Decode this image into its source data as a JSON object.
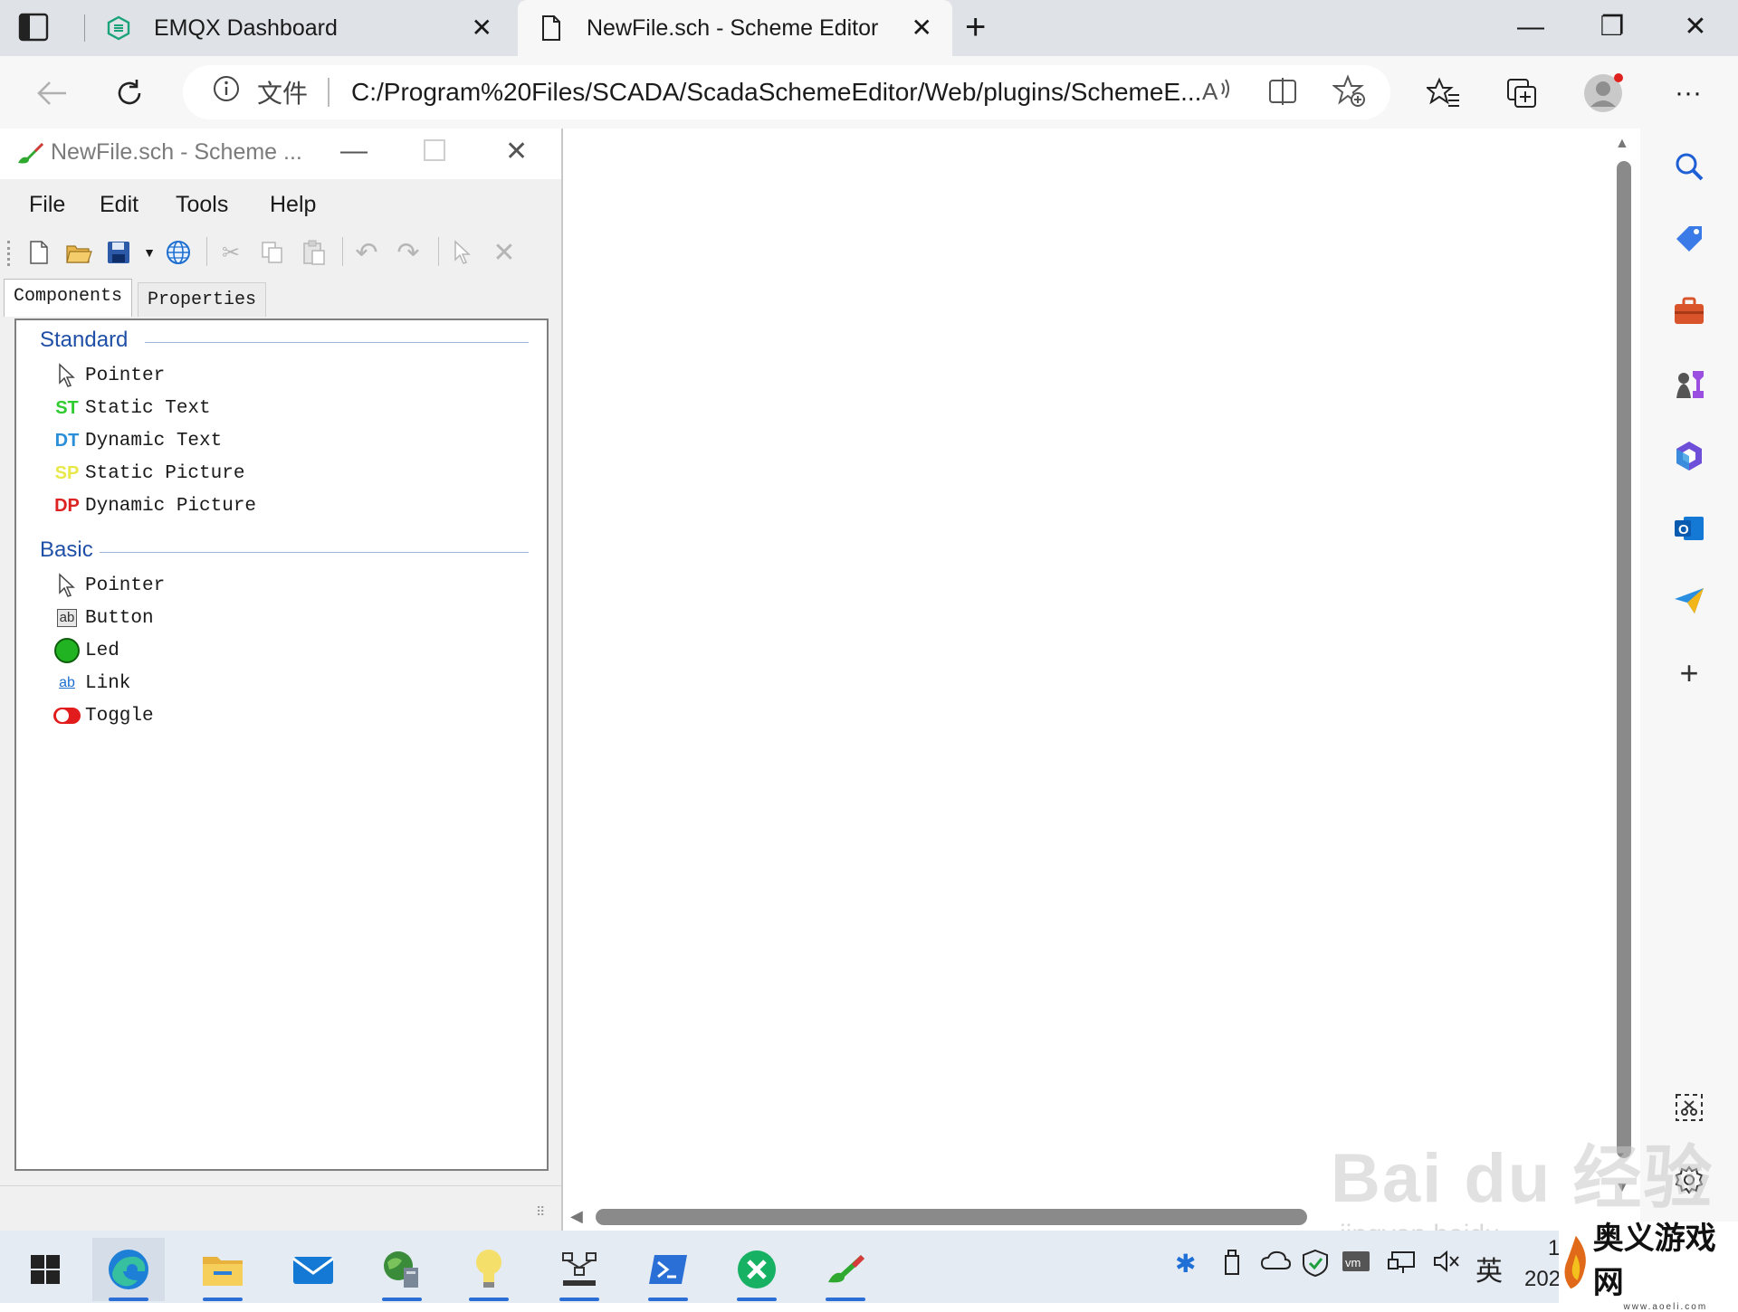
{
  "browser": {
    "tabs": [
      {
        "title": "EMQX Dashboard",
        "icon": "emqx-hexagon-icon"
      },
      {
        "title": "NewFile.sch - Scheme Editor",
        "icon": "document-icon",
        "active": true
      }
    ],
    "new_tab_label": "+",
    "address": {
      "file_label": "文件",
      "url": "C:/Program%20Files/SCADA/ScadaSchemeEditor/Web/plugins/SchemeE..."
    }
  },
  "editor": {
    "title": "NewFile.sch - Scheme ...",
    "menu": [
      "File",
      "Edit",
      "Tools",
      "Help"
    ],
    "tabs": {
      "components": "Components",
      "properties": "Properties"
    },
    "groups": [
      {
        "name": "Standard",
        "items": [
          {
            "icon": "pointer",
            "icon_text": "",
            "label": "Pointer",
            "color": "#000000"
          },
          {
            "icon": "static-text",
            "icon_text": "ST",
            "label": "Static Text",
            "color": "#2fcc2f"
          },
          {
            "icon": "dynamic-text",
            "icon_text": "DT",
            "label": "Dynamic Text",
            "color": "#2a8fd8"
          },
          {
            "icon": "static-picture",
            "icon_text": "SP",
            "label": "Static Picture",
            "color": "#e8e84a"
          },
          {
            "icon": "dynamic-picture",
            "icon_text": "DP",
            "label": "Dynamic Picture",
            "color": "#dd2222"
          }
        ]
      },
      {
        "name": "Basic",
        "items": [
          {
            "icon": "pointer",
            "icon_text": "",
            "label": "Pointer"
          },
          {
            "icon": "button",
            "icon_text": "ab",
            "label": "Button"
          },
          {
            "icon": "led",
            "icon_text": "",
            "label": "Led"
          },
          {
            "icon": "link",
            "icon_text": "ab",
            "label": "Link"
          },
          {
            "icon": "toggle",
            "icon_text": "",
            "label": "Toggle"
          }
        ]
      }
    ]
  },
  "watermark": {
    "main": "Bai du 经验",
    "sub": "jingyan.baidu"
  },
  "taskbar": {
    "ime": "英",
    "clock_partial": "202",
    "clock_top_partial": "1"
  },
  "badge": {
    "text": "奥义游戏网",
    "sub": "www.aoeli.com"
  }
}
